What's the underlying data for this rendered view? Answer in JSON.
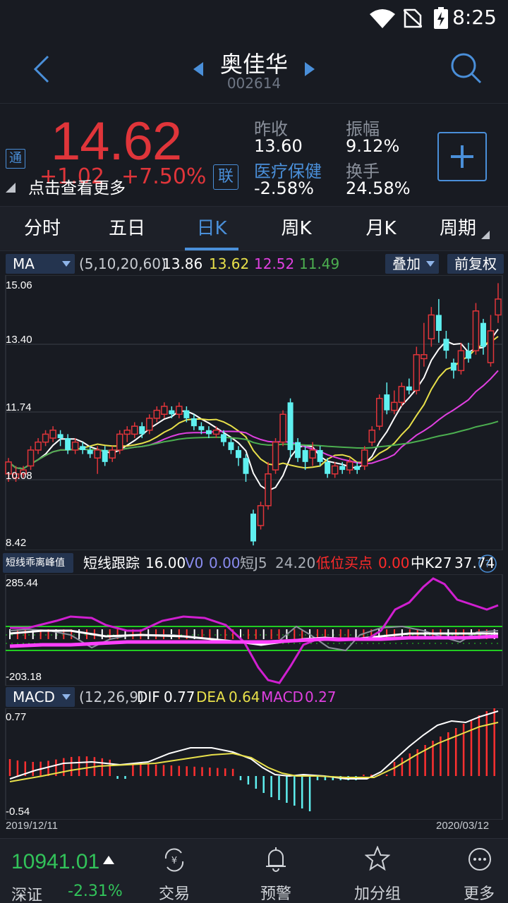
{
  "status": {
    "time": "8:25"
  },
  "header": {
    "name": "奥佳华",
    "code": "002614"
  },
  "quote": {
    "price": "14.62",
    "change": "+1.02",
    "change_pct": "+7.50%",
    "hint": "点击查看更多",
    "tong": "通",
    "lian": "联",
    "prev_close_label": "昨收",
    "prev_close": "13.60",
    "sector_label": "医疗保健",
    "sector_change": "-2.58%",
    "amplitude_label": "振幅",
    "amplitude": "9.12%",
    "turnover_label": "换手",
    "turnover": "24.58%"
  },
  "tabs": [
    {
      "label": "分时"
    },
    {
      "label": "五日"
    },
    {
      "label": "日K"
    },
    {
      "label": "周K"
    },
    {
      "label": "月K"
    },
    {
      "label": "周期"
    }
  ],
  "ma_bar": {
    "select": "MA",
    "params": "(5,10,20,60)",
    "v1": "13.86",
    "v2": "13.62",
    "v3": "12.52",
    "v4": "11.49",
    "overlay": "叠加",
    "adjust": "前复权"
  },
  "price_axis": [
    "15.06",
    "13.40",
    "11.74",
    "10.08",
    "8.42"
  ],
  "short_bar": {
    "select": "短线乖离峰值",
    "name": "短线跟踪",
    "v_main": "16.00",
    "v0_label": "V0",
    "v0": "0.00",
    "j5_label": "短J5",
    "j5": "24.20",
    "buy_label": "低位买点",
    "buy": "0.00",
    "k27_label": "中K27",
    "k27": "37.74"
  },
  "short_axis": [
    "285.44",
    "-203.18"
  ],
  "macd_bar": {
    "select": "MACD",
    "params": "(12,26,9)",
    "dif_label": "DIF",
    "dif": "0.77",
    "dea_label": "DEA",
    "dea": "0.64",
    "macd_label": "MACD",
    "macd": "0.27"
  },
  "macd_axis": [
    "0.77",
    "-0.54"
  ],
  "dates": {
    "start": "2019/12/11",
    "end": "2020/03/12"
  },
  "footer": {
    "index_value": "10941.01",
    "index_name": "深证",
    "index_change": "-2.31%",
    "items": [
      {
        "label": "交易",
        "icon": "trade-icon"
      },
      {
        "label": "预警",
        "icon": "bell-icon"
      },
      {
        "label": "加分组",
        "icon": "star-icon"
      },
      {
        "label": "更多",
        "icon": "more-icon"
      }
    ]
  },
  "colors": {
    "up": "#e0353a",
    "down": "#5ff0f0",
    "accent": "#4a8fd9",
    "ma5": "#ffffff",
    "ma10": "#e8e04a",
    "ma20": "#e040e0",
    "ma60": "#4caf50"
  },
  "chart_data": {
    "type": "candlestick",
    "price_range": [
      8.42,
      15.06
    ],
    "candles": [
      [
        10.2,
        10.5,
        10.0,
        10.6
      ],
      [
        10.1,
        10.2,
        10.0,
        10.4
      ],
      [
        10.2,
        10.3,
        10.1,
        10.4
      ],
      [
        10.4,
        10.8,
        10.3,
        10.9
      ],
      [
        10.8,
        11.0,
        10.7,
        11.1
      ],
      [
        11.0,
        11.2,
        10.9,
        11.3
      ],
      [
        11.1,
        11.3,
        11.0,
        11.4
      ],
      [
        11.2,
        11.1,
        10.9,
        11.3
      ],
      [
        11.1,
        10.8,
        10.7,
        11.2
      ],
      [
        10.8,
        11.0,
        10.7,
        11.1
      ],
      [
        10.9,
        10.8,
        10.7,
        11.0
      ],
      [
        10.8,
        10.7,
        10.6,
        10.9
      ],
      [
        10.6,
        10.8,
        10.2,
        10.9
      ],
      [
        10.8,
        10.5,
        10.4,
        10.9
      ],
      [
        10.6,
        10.8,
        10.5,
        10.9
      ],
      [
        10.8,
        11.2,
        10.7,
        11.3
      ],
      [
        11.2,
        11.3,
        11.0,
        11.4
      ],
      [
        11.2,
        11.4,
        11.1,
        11.5
      ],
      [
        11.4,
        11.2,
        11.1,
        11.5
      ],
      [
        11.3,
        11.6,
        11.2,
        11.7
      ],
      [
        11.6,
        11.8,
        11.5,
        11.9
      ],
      [
        11.7,
        11.9,
        11.6,
        12.0
      ],
      [
        11.8,
        11.7,
        11.6,
        11.9
      ],
      [
        11.7,
        11.9,
        11.6,
        12.0
      ],
      [
        11.8,
        11.6,
        11.5,
        11.9
      ],
      [
        11.6,
        11.4,
        11.3,
        11.7
      ],
      [
        11.4,
        11.3,
        11.2,
        11.5
      ],
      [
        11.3,
        11.2,
        11.1,
        11.4
      ],
      [
        11.2,
        11.3,
        11.1,
        11.4
      ],
      [
        11.2,
        11.0,
        10.9,
        11.3
      ],
      [
        11.0,
        10.8,
        10.7,
        11.1
      ],
      [
        10.8,
        10.6,
        10.4,
        10.9
      ],
      [
        10.6,
        10.2,
        10.0,
        10.7
      ],
      [
        9.2,
        8.5,
        8.4,
        9.3
      ],
      [
        8.9,
        9.4,
        8.8,
        9.5
      ],
      [
        9.4,
        10.2,
        9.3,
        10.5
      ],
      [
        10.3,
        11.0,
        10.2,
        11.1
      ],
      [
        11.0,
        11.7,
        10.9,
        11.8
      ],
      [
        12.0,
        10.8,
        10.6,
        12.1
      ],
      [
        11.0,
        10.6,
        10.5,
        11.1
      ],
      [
        10.8,
        10.5,
        10.3,
        10.9
      ],
      [
        10.6,
        10.8,
        10.4,
        11.0
      ],
      [
        10.8,
        10.5,
        10.4,
        10.9
      ],
      [
        10.5,
        10.2,
        10.1,
        10.6
      ],
      [
        10.2,
        10.4,
        10.1,
        10.5
      ],
      [
        10.4,
        10.3,
        10.2,
        10.5
      ],
      [
        10.3,
        10.5,
        10.2,
        10.6
      ],
      [
        10.4,
        10.3,
        10.2,
        10.5
      ],
      [
        10.4,
        10.8,
        10.3,
        10.9
      ],
      [
        11.0,
        11.3,
        10.9,
        11.4
      ],
      [
        11.4,
        12.1,
        11.3,
        12.2
      ],
      [
        12.2,
        11.8,
        11.7,
        12.5
      ],
      [
        11.8,
        12.0,
        11.7,
        12.3
      ],
      [
        12.0,
        12.4,
        11.9,
        12.5
      ],
      [
        12.4,
        12.3,
        12.2,
        12.6
      ],
      [
        12.3,
        13.2,
        12.2,
        13.4
      ],
      [
        13.1,
        13.2,
        12.9,
        14.0
      ],
      [
        13.6,
        14.2,
        13.4,
        14.4
      ],
      [
        14.2,
        13.8,
        13.5,
        14.6
      ],
      [
        13.6,
        13.3,
        13.1,
        13.8
      ],
      [
        13.0,
        12.8,
        12.6,
        13.1
      ],
      [
        12.8,
        13.3,
        12.7,
        13.5
      ],
      [
        13.3,
        13.1,
        13.0,
        13.5
      ],
      [
        13.3,
        14.3,
        13.2,
        14.5
      ],
      [
        14.0,
        13.4,
        13.2,
        14.1
      ],
      [
        13.0,
        13.8,
        12.9,
        14.2
      ],
      [
        14.2,
        14.6,
        14.0,
        15.0
      ]
    ]
  }
}
